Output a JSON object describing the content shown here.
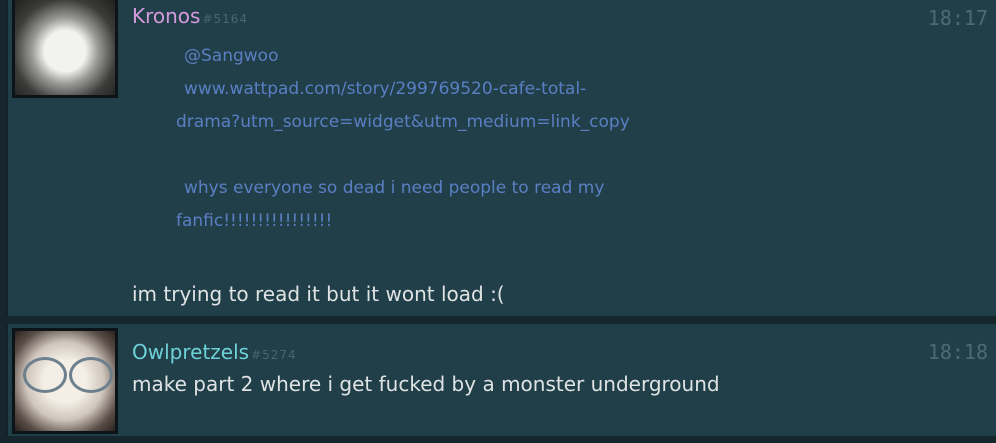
{
  "messages": [
    {
      "user": "Kronos",
      "tag": "#5164",
      "time": "18:17",
      "quote": {
        "mention": "@Sangwoo",
        "link_line1": "www.wattpad.com/story/299769520-cafe-total-",
        "link_line2": "drama?utm_source=widget&utm_medium=link_copy",
        "text_line1": "whys everyone so dead i need people to read my",
        "text_line2": "fanfic!!!!!!!!!!!!!!!!"
      },
      "body": "im trying to read it but it wont load :("
    },
    {
      "user": "Owlpretzels",
      "tag": "#5274",
      "time": "18:18",
      "body": "make part 2 where i get fucked by a monster underground"
    }
  ]
}
